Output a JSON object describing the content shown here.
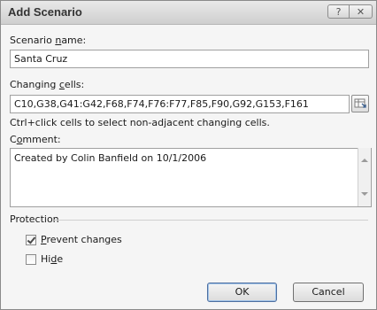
{
  "window": {
    "title": "Add Scenario",
    "help_glyph": "?",
    "close_glyph": "✕"
  },
  "scenario_name": {
    "label_pre": "Scenario ",
    "label_u": "n",
    "label_post": "ame:",
    "value": "Santa Cruz"
  },
  "changing_cells": {
    "label_pre": "Changing ",
    "label_u": "c",
    "label_post": "ells:",
    "value": "C10,G38,G41:G42,F68,F74,F76:F77,F85,F90,G92,G153,F161",
    "hint": "Ctrl+click cells to select non-adjacent changing cells."
  },
  "comment": {
    "label_pre": "C",
    "label_u": "o",
    "label_post": "mment:",
    "value": "Created by Colin Banfield on 10/1/2006"
  },
  "protection": {
    "group_label": "Protection",
    "prevent_changes": {
      "checked": true,
      "label_u": "P",
      "label_post": "revent changes"
    },
    "hide": {
      "checked": false,
      "label_pre": "Hi",
      "label_u": "d",
      "label_post": "e"
    }
  },
  "buttons": {
    "ok": "OK",
    "cancel": "Cancel"
  },
  "icons": {
    "collapse": "collapse-dialog-icon",
    "scroll_up": "scroll-up-icon",
    "scroll_down": "scroll-down-icon",
    "check": "checkmark-icon"
  }
}
